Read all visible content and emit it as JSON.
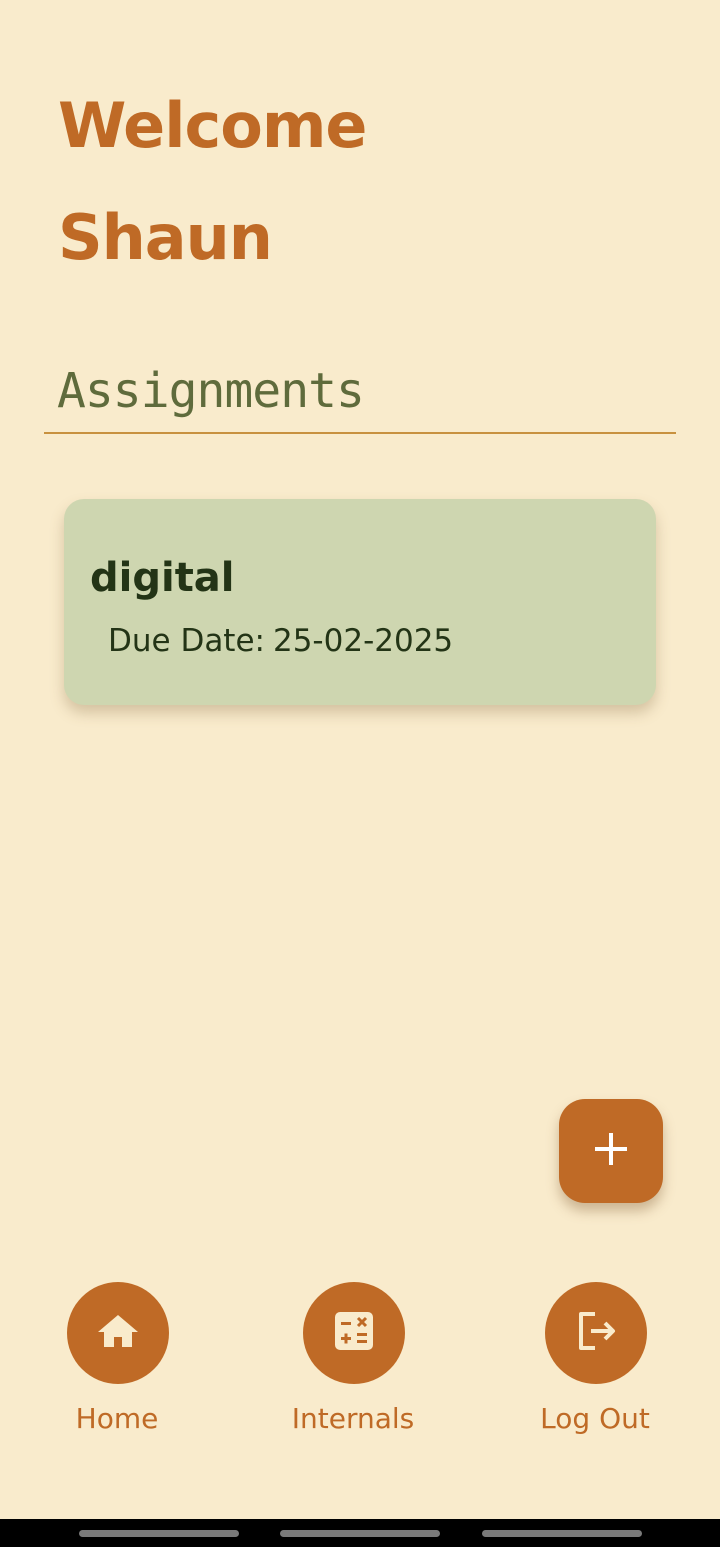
{
  "header": {
    "line1": "Welcome",
    "line2": "Shaun"
  },
  "assignments": {
    "section_title": "Assignments",
    "items": [
      {
        "title": "digital",
        "due_label": "Due Date:",
        "due_value": "25-02-2025"
      }
    ]
  },
  "fab": {
    "icon": "plus-icon"
  },
  "bottom_nav": {
    "items": [
      {
        "label": "Home",
        "icon": "home-icon"
      },
      {
        "label": "Internals",
        "icon": "calculator-icon"
      },
      {
        "label": "Log Out",
        "icon": "logout-icon"
      }
    ]
  },
  "colors": {
    "background": "#f9ebcc",
    "accent": "#bf6a26",
    "card": "#ced6b0",
    "section_title": "#5f6b3c",
    "card_text": "#233416"
  }
}
